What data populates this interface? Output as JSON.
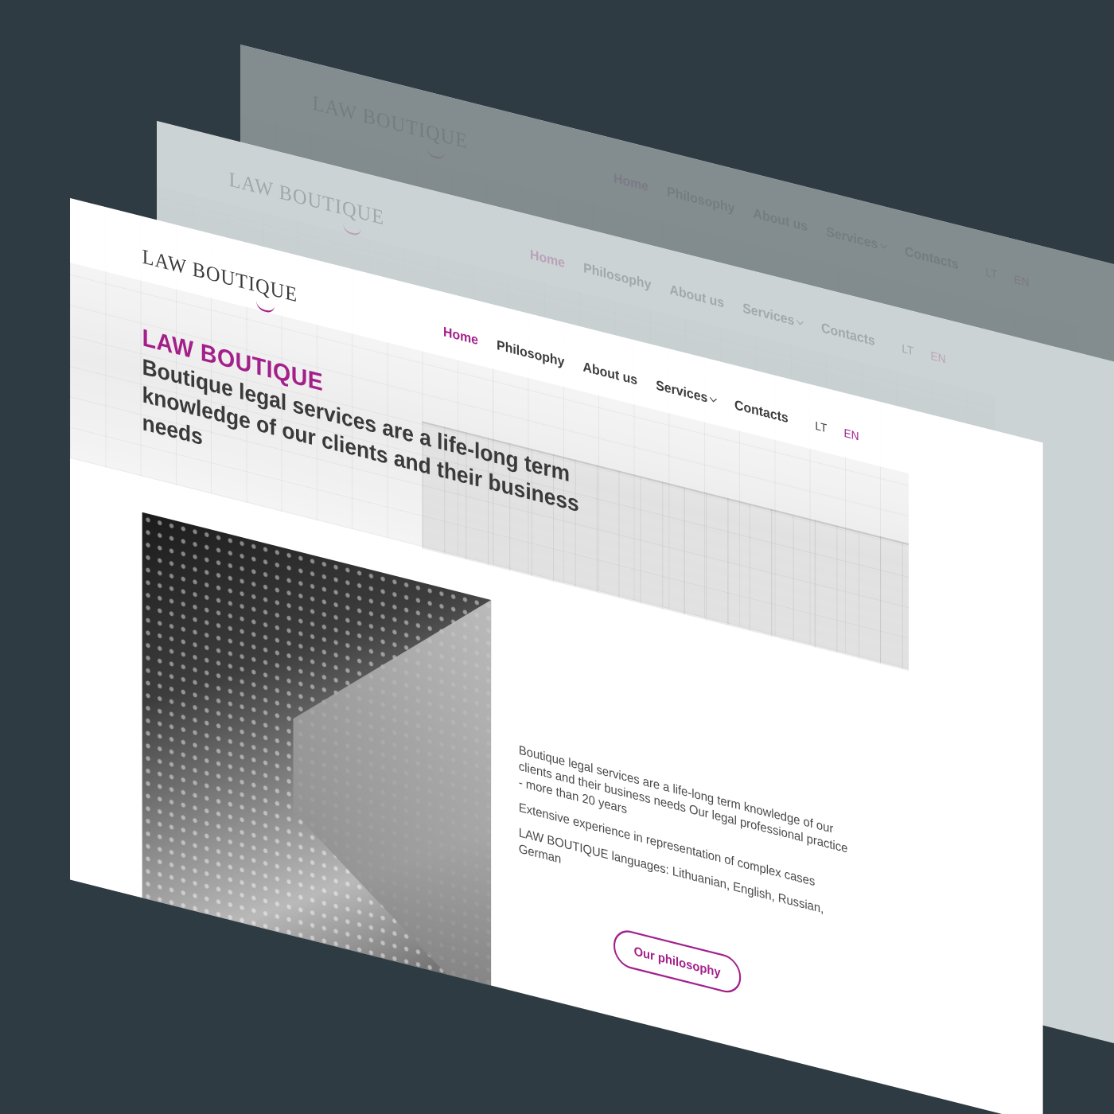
{
  "site": {
    "logo": "LAW BOUTIQUE",
    "nav": [
      {
        "label": "Home"
      },
      {
        "label": "Philosophy"
      },
      {
        "label": "About us"
      },
      {
        "label": "Services"
      },
      {
        "label": "Contacts"
      }
    ],
    "languages": [
      "LT",
      "EN"
    ],
    "active_language": "EN",
    "hero": {
      "brand": "LAW BOUTIQUE",
      "tagline": "Boutique legal services are a life-long term knowledge of our clients and their business needs"
    },
    "body": {
      "p1": "Boutique legal services are a life-long term knowledge of our clients and their business needs Our legal professional practice - more than 20 years",
      "p2": "Extensive experience in representation of complex cases",
      "p3": "LAW BOUTIQUE languages: Lithuanian, English, Russian, German"
    },
    "cta": "Our philosophy"
  },
  "colors": {
    "accent": "#a3208a",
    "background": "#2e3b42",
    "text": "#3a3a3a"
  },
  "icons": {
    "services_dropdown": "chevron-down-icon"
  }
}
